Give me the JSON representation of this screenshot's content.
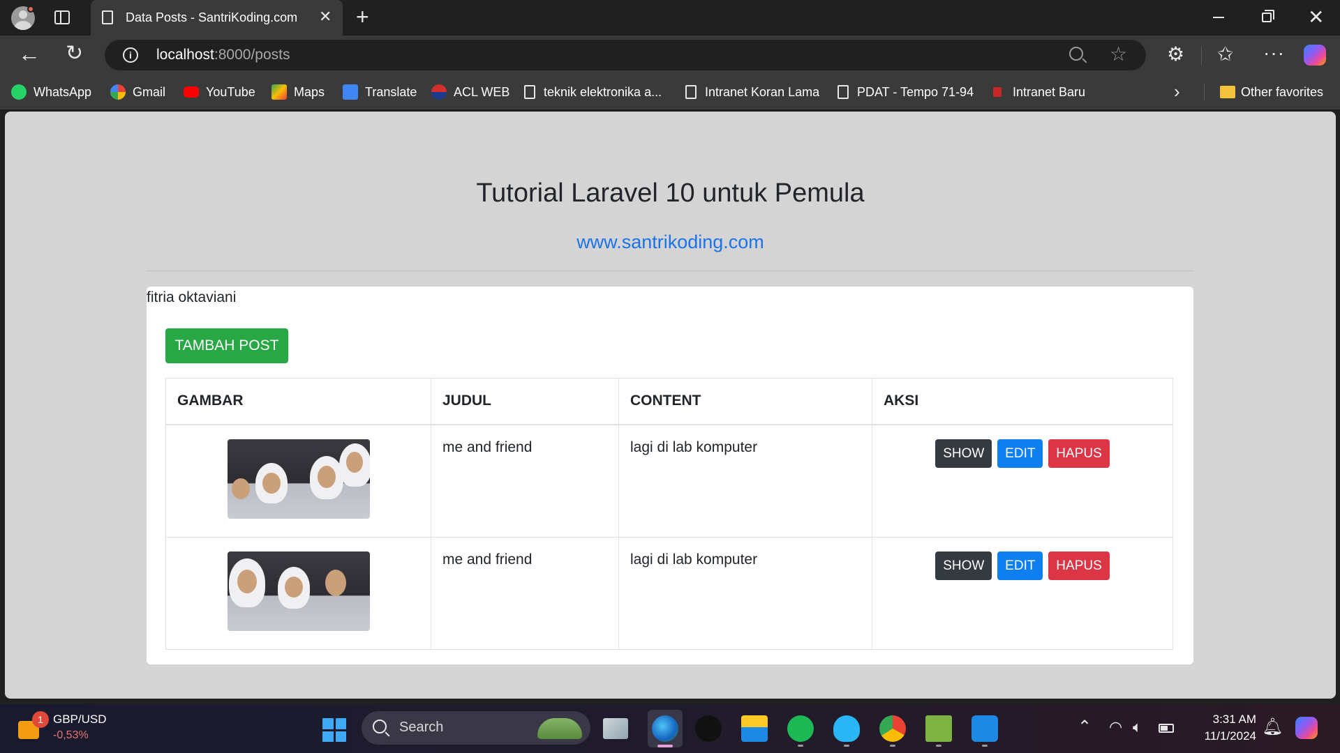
{
  "browser": {
    "tab_title": "Data Posts - SantriKoding.com",
    "tab_close": "✕",
    "new_tab": "+",
    "url_host": "localhost",
    "url_path": ":8000/posts",
    "window_close": "✕"
  },
  "bookmarks": [
    {
      "label": "WhatsApp",
      "icon": "whatsapp-icon",
      "color": "#25d366"
    },
    {
      "label": "Gmail",
      "icon": "google-icon",
      "color": "#4285f4"
    },
    {
      "label": "YouTube",
      "icon": "youtube-icon",
      "color": "#ff0000"
    },
    {
      "label": "Maps",
      "icon": "maps-icon",
      "color": "#34a853"
    },
    {
      "label": "Translate",
      "icon": "translate-icon",
      "color": "#4285f4"
    },
    {
      "label": "ACL WEB",
      "icon": "acl-icon",
      "color": "#d32f2f"
    },
    {
      "label": "teknik elektronika a...",
      "icon": "page-icon"
    },
    {
      "label": "Intranet Koran Lama",
      "icon": "page-icon"
    },
    {
      "label": "PDAT - Tempo 71-94",
      "icon": "page-icon"
    },
    {
      "label": "Intranet Baru",
      "icon": "intranet-icon",
      "color": "#c62828"
    }
  ],
  "other_favorites": "Other favorites",
  "page": {
    "title": "Tutorial Laravel 10 untuk Pemula",
    "link": "www.santrikoding.com",
    "user_name": "fitria oktaviani",
    "add_button": "TAMBAH POST",
    "columns": [
      "GAMBAR",
      "JUDUL",
      "CONTENT",
      "AKSI"
    ],
    "rows": [
      {
        "judul": "me and friend",
        "content": "lagi di lab komputer"
      },
      {
        "judul": "me and friend",
        "content": "lagi di lab komputer"
      }
    ],
    "actions": {
      "show": "SHOW",
      "edit": "EDIT",
      "hapus": "HAPUS"
    }
  },
  "taskbar": {
    "stock_badge": "1",
    "stock_name": "GBP/USD",
    "stock_value": "-0,53%",
    "search_label": "Search",
    "time": "3:31 AM",
    "date": "11/1/2024"
  },
  "colors": {
    "accent_link": "#1a73e8",
    "btn_add": "#28a745",
    "btn_show": "#343a40",
    "btn_edit": "#0d7ff0",
    "btn_hapus": "#dc3545"
  }
}
